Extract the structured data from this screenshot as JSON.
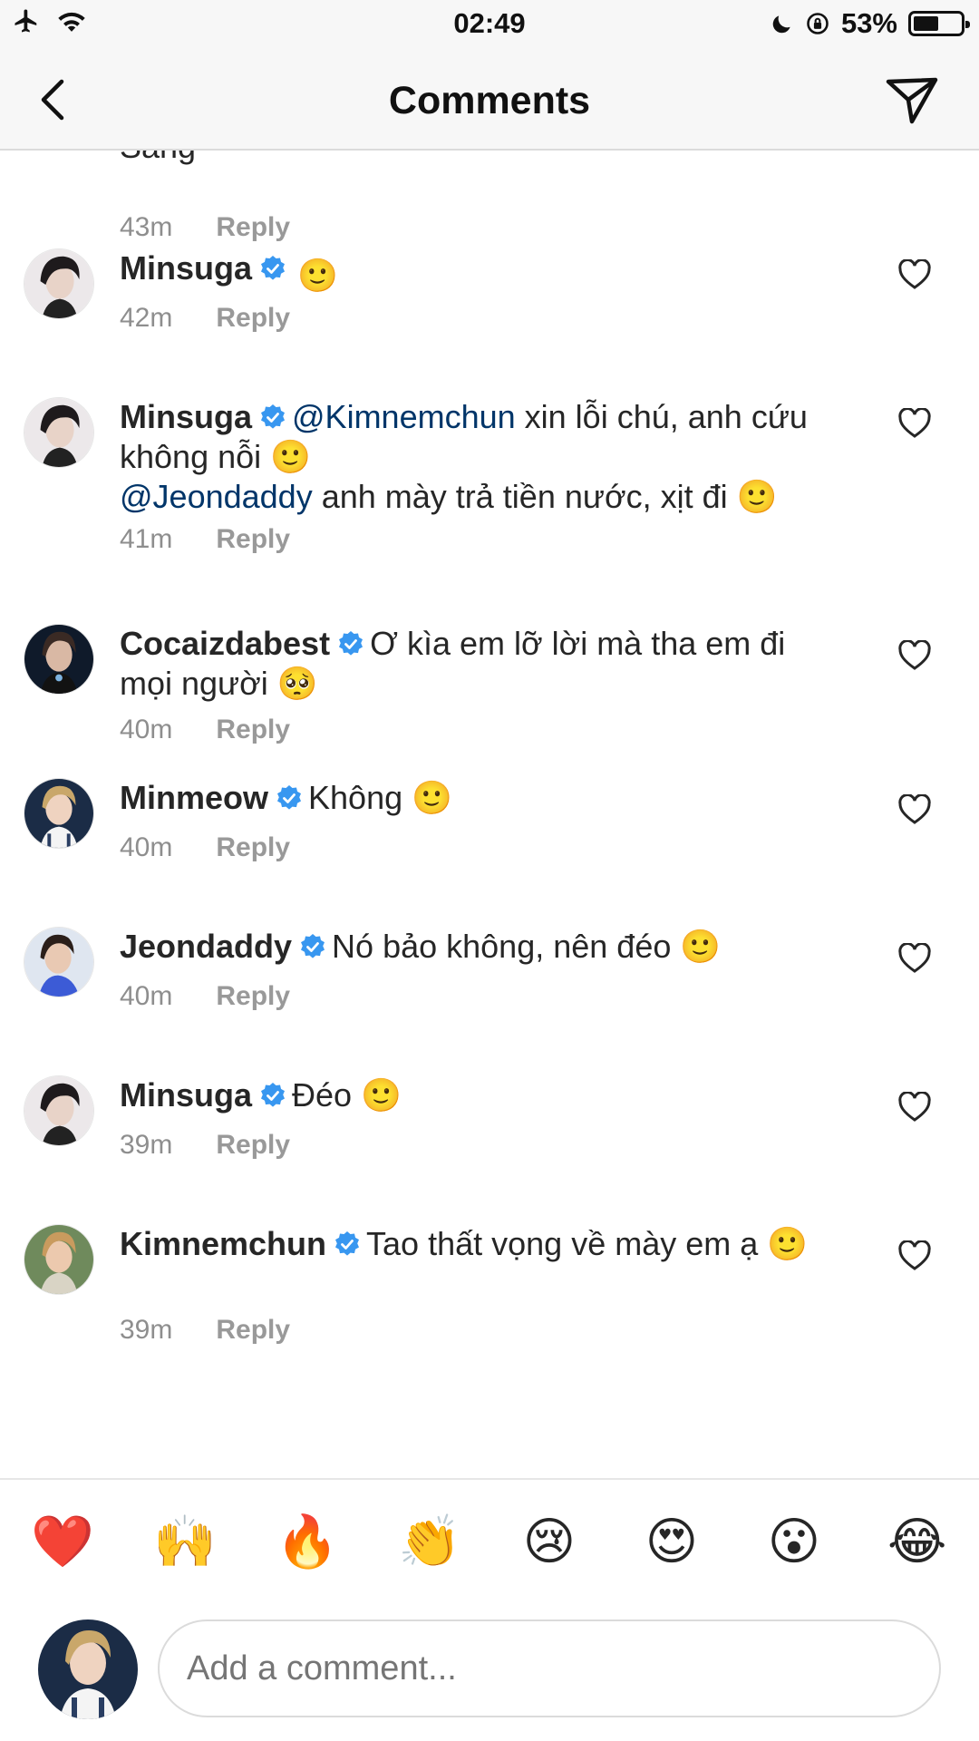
{
  "status_bar": {
    "time": "02:49",
    "battery": "53%",
    "battery_level": 0.53,
    "icons": [
      "airplane-icon",
      "wifi-icon",
      "moon-icon",
      "rotation-lock-icon",
      "battery-icon"
    ]
  },
  "nav": {
    "title": "Comments",
    "icons": [
      "back-chevron-icon",
      "send-icon"
    ]
  },
  "comments": [
    {
      "user": "",
      "text": "Sáng",
      "time": "43m",
      "reply": "Reply"
    },
    {
      "user": "Minsuga",
      "text": "",
      "emoji": "🙂",
      "time": "42m",
      "reply": "Reply"
    },
    {
      "user": "Minsuga",
      "mention1": "@Kimnemchun",
      "text1": " xin lỗi chú, anh cứu không nỗi ",
      "emoji1": "🙂",
      "mention2": "@Jeondaddy",
      "text2": " anh mày trả tiền nước, xịt đi ",
      "emoji2": "🙂",
      "time": "41m",
      "reply": "Reply"
    },
    {
      "user": "Cocaizdabest",
      "text": "Ơ kìa em lỡ lời mà tha em đi mọi người ",
      "emoji": "🥺",
      "time": "40m",
      "reply": "Reply"
    },
    {
      "user": "Minmeow",
      "text": "Không ",
      "emoji": "🙂",
      "time": "40m",
      "reply": "Reply"
    },
    {
      "user": "Jeondaddy",
      "text": "Nó bảo không, nên đéo ",
      "emoji": "🙂",
      "time": "40m",
      "reply": "Reply"
    },
    {
      "user": "Minsuga",
      "text": "Đéo ",
      "emoji": "🙂",
      "time": "39m",
      "reply": "Reply"
    },
    {
      "user": "Kimnemchun",
      "text": "Tao thất vọng về mày em ạ ",
      "emoji": "🙂",
      "time": "39m",
      "reply": "Reply"
    }
  ],
  "reactions": [
    "❤️",
    "🙌",
    "🔥",
    "👏",
    "😢",
    "😍",
    "😮",
    "😂"
  ],
  "composer": {
    "placeholder": "Add a comment..."
  },
  "colors": {
    "verified": "#3897f0",
    "mention": "#003569",
    "meta": "#8e8e8e",
    "text": "#262626"
  }
}
